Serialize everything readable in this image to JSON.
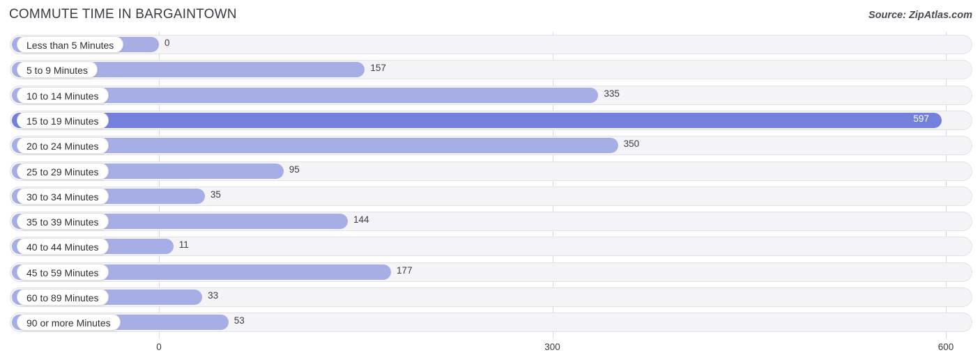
{
  "header": {
    "title": "COMMUTE TIME IN BARGAINTOWN",
    "source": "Source: ZipAtlas.com"
  },
  "colors": {
    "bar": "#a7aee6",
    "bar_highlight": "#7480dc",
    "track": "#f4f4f6",
    "gridline": "#d8d8dc",
    "label_text": "#2e2e34"
  },
  "chart_data": {
    "type": "bar",
    "orientation": "horizontal",
    "title": "COMMUTE TIME IN BARGAINTOWN",
    "xlabel": "",
    "ylabel": "",
    "xlim": [
      0,
      600
    ],
    "xticks": [
      "0",
      "300",
      "600"
    ],
    "xtick_values": [
      0,
      300,
      600
    ],
    "grid": true,
    "legend": "none",
    "highlight_category": "15 to 19 Minutes",
    "categories": [
      "Less than 5 Minutes",
      "5 to 9 Minutes",
      "10 to 14 Minutes",
      "15 to 19 Minutes",
      "20 to 24 Minutes",
      "25 to 29 Minutes",
      "30 to 34 Minutes",
      "35 to 39 Minutes",
      "40 to 44 Minutes",
      "45 to 59 Minutes",
      "60 to 89 Minutes",
      "90 or more Minutes"
    ],
    "values": [
      0,
      157,
      335,
      597,
      350,
      95,
      35,
      144,
      11,
      177,
      33,
      53
    ],
    "value_labels": [
      "0",
      "157",
      "335",
      "597",
      "350",
      "95",
      "35",
      "144",
      "11",
      "177",
      "33",
      "53"
    ]
  },
  "rows": [
    {
      "label": "Less than 5 Minutes",
      "value": 0,
      "value_label": "0",
      "highlight": false,
      "label_inside": true
    },
    {
      "label": "5 to 9 Minutes",
      "value": 157,
      "value_label": "157",
      "highlight": false,
      "label_inside": true
    },
    {
      "label": "10 to 14 Minutes",
      "value": 335,
      "value_label": "335",
      "highlight": false,
      "label_inside": true
    },
    {
      "label": "15 to 19 Minutes",
      "value": 597,
      "value_label": "597",
      "highlight": true,
      "label_inside": true
    },
    {
      "label": "20 to 24 Minutes",
      "value": 350,
      "value_label": "350",
      "highlight": false,
      "label_inside": true
    },
    {
      "label": "25 to 29 Minutes",
      "value": 95,
      "value_label": "95",
      "highlight": false,
      "label_inside": true
    },
    {
      "label": "30 to 34 Minutes",
      "value": 35,
      "value_label": "35",
      "highlight": false,
      "label_inside": true
    },
    {
      "label": "35 to 39 Minutes",
      "value": 144,
      "value_label": "144",
      "highlight": false,
      "label_inside": true
    },
    {
      "label": "40 to 44 Minutes",
      "value": 11,
      "value_label": "11",
      "highlight": false,
      "label_inside": true
    },
    {
      "label": "45 to 59 Minutes",
      "value": 177,
      "value_label": "177",
      "highlight": false,
      "label_inside": true
    },
    {
      "label": "60 to 89 Minutes",
      "value": 33,
      "value_label": "33",
      "highlight": false,
      "label_inside": true
    },
    {
      "label": "90 or more Minutes",
      "value": 53,
      "value_label": "53",
      "highlight": false,
      "label_inside": true
    }
  ],
  "axis": {
    "ticks": [
      {
        "label": "0",
        "value": 0
      },
      {
        "label": "300",
        "value": 300
      },
      {
        "label": "600",
        "value": 600
      }
    ]
  }
}
